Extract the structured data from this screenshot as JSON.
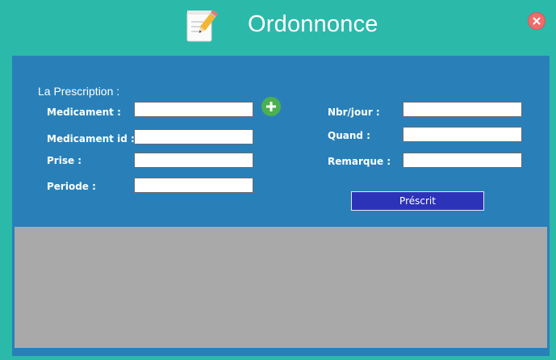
{
  "window": {
    "title": "Ordonnonce",
    "title_icon": "notepad-pencil-icon",
    "close_icon": "close-icon"
  },
  "form": {
    "section_label": "La Prescription :",
    "add_icon": "plus-icon",
    "left_fields": [
      {
        "label": "Medicament :",
        "value": "",
        "placeholder": ""
      },
      {
        "label": "Medicament id :",
        "value": "",
        "placeholder": ""
      },
      {
        "label": "Prise :",
        "value": "",
        "placeholder": ""
      },
      {
        "label": "Periode :",
        "value": "",
        "placeholder": ""
      }
    ],
    "right_fields": [
      {
        "label": "Nbr/jour :",
        "value": "",
        "placeholder": ""
      },
      {
        "label": "Quand :",
        "value": "",
        "placeholder": ""
      },
      {
        "label": "Remarque :",
        "value": "",
        "placeholder": ""
      }
    ],
    "submit_label": "Préscrit"
  },
  "colors": {
    "window_bg": "#2bb9aa",
    "panel_bg": "#2980b9",
    "submit_bg": "#2d33b8",
    "add_bg": "#4caf50",
    "close_bg": "#f06b6b",
    "grid_bg": "#a9a9a9"
  }
}
